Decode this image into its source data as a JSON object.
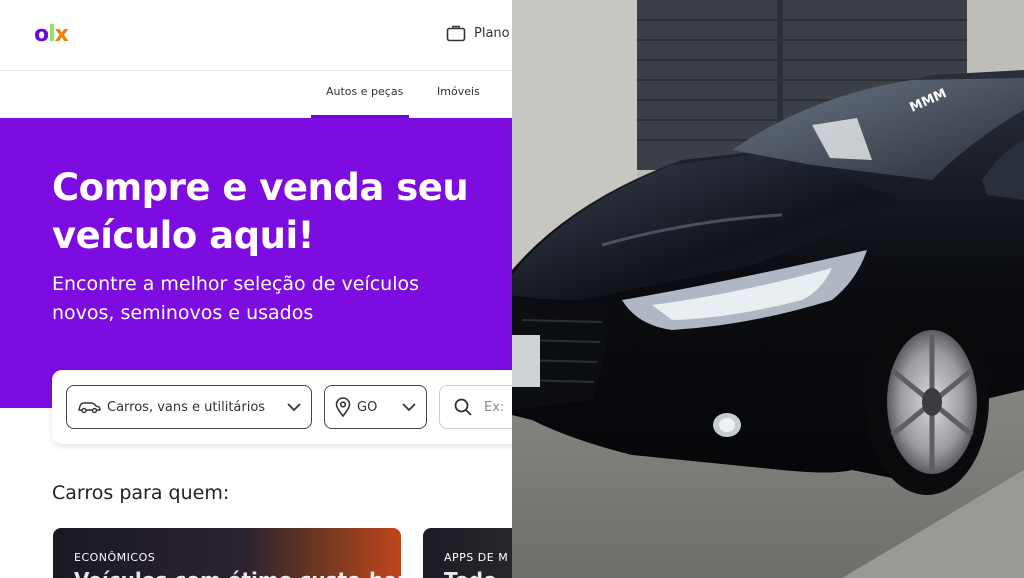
{
  "header": {
    "logo": {
      "o": "o",
      "l": "l",
      "x": "x"
    },
    "plan_label": "Plano",
    "plan_icon": "briefcase-icon"
  },
  "tabs": [
    {
      "label": "Autos e peças",
      "active": true
    },
    {
      "label": "Imóveis",
      "active": false
    }
  ],
  "hero": {
    "title_line1": "Compre e venda seu",
    "title_line2": "veículo aqui!",
    "subtitle_line1": "Encontre a melhor seleção de veículos",
    "subtitle_line2": "novos, seminovos e usados",
    "background": "#7d0ce0"
  },
  "search": {
    "category": {
      "icon": "car-icon",
      "value": "Carros, vans e utilitários",
      "chevron": "chevron-down-icon"
    },
    "state": {
      "icon": "location-pin-icon",
      "value": "GO",
      "chevron": "chevron-down-icon"
    },
    "query": {
      "icon": "search-icon",
      "placeholder": "Ex:"
    }
  },
  "section": {
    "title": "Carros para quem:"
  },
  "cards": [
    {
      "tag": "ECONÔMICOS",
      "title": "Veículos com ótimo custo-benefício"
    },
    {
      "tag": "APPS DE M",
      "title": "Todo"
    }
  ],
  "colors": {
    "brand_purple": "#6e0ad6",
    "logo_green": "#8ce563",
    "logo_orange": "#f28000"
  },
  "photo": {
    "subject": "car-photo",
    "windshield_text": "MMM"
  }
}
